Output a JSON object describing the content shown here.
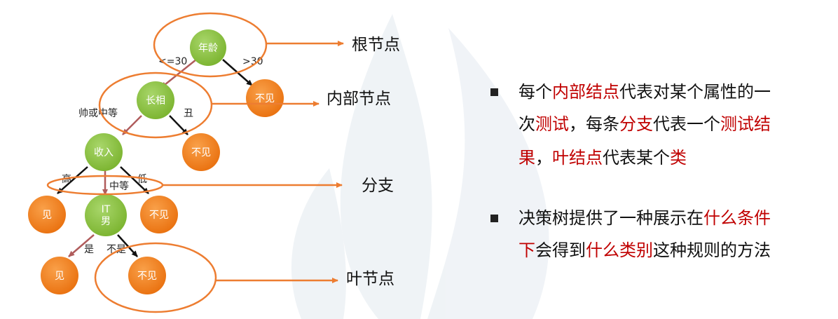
{
  "colors": {
    "node_green": "#8dc63f",
    "node_orange": "#f58220",
    "callout_orange": "#ed7d31",
    "branch_red": "#b05c5c",
    "highlight": "#c00000"
  },
  "tree": {
    "nodes": {
      "age": "年龄",
      "looks": "长相",
      "no_meet_1": "不见",
      "income": "收入",
      "no_meet_2": "不见",
      "meet_1": "见",
      "it_line1": "IT",
      "it_line2": "男",
      "no_meet_3": "不见",
      "meet_2": "见",
      "no_meet_4": "不见"
    },
    "edges": {
      "le30": "<=30",
      "gt30": ">30",
      "handsome_or_mid": "帅或中等",
      "ugly": "丑",
      "high": "高",
      "medium": "中等",
      "low": "低",
      "yes": "是",
      "no": "不是"
    }
  },
  "callouts": {
    "root": "根节点",
    "internal": "内部节点",
    "branch": "分支",
    "leaf": "叶节点"
  },
  "bullets": [
    {
      "lines": [
        [
          {
            "t": "每个",
            "h": false
          },
          {
            "t": "内部结点",
            "h": true
          },
          {
            "t": "代表对某个属性的一",
            "h": false
          }
        ],
        [
          {
            "t": "次",
            "h": false
          },
          {
            "t": "测试",
            "h": true
          },
          {
            "t": "，每条",
            "h": false
          },
          {
            "t": "分支",
            "h": true
          },
          {
            "t": "代表一个",
            "h": false
          },
          {
            "t": "测试结",
            "h": true
          }
        ],
        [
          {
            "t": "果",
            "h": true
          },
          {
            "t": "，",
            "h": false
          },
          {
            "t": "叶结点",
            "h": true
          },
          {
            "t": "代表某个",
            "h": false
          },
          {
            "t": "类",
            "h": true
          }
        ]
      ]
    },
    {
      "lines": [
        [
          {
            "t": "决策树提供了一种展示在",
            "h": false
          },
          {
            "t": "什么条件",
            "h": true
          }
        ],
        [
          {
            "t": "下",
            "h": true
          },
          {
            "t": "会得到",
            "h": false
          },
          {
            "t": "什么类别",
            "h": true
          },
          {
            "t": "这种规则的方法",
            "h": false
          }
        ]
      ]
    }
  ]
}
